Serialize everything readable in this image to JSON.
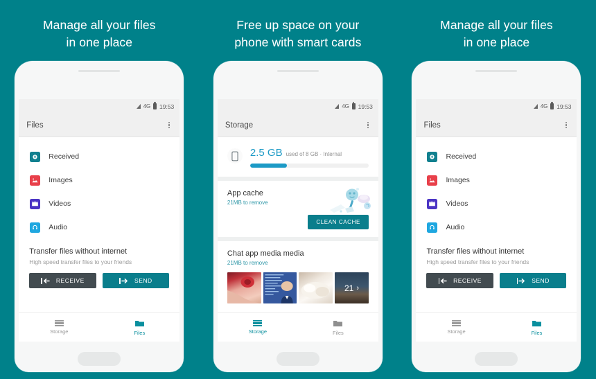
{
  "theme": {
    "background_teal": "#00818a",
    "accent_teal": "#0a7e8c",
    "nav_active": "#0a8f9e",
    "progress_blue": "#1c9ac6",
    "receive_dark": "#424b50"
  },
  "panels": [
    {
      "headline_line1": "Manage all your files",
      "headline_line2": "in one place",
      "screen": "files"
    },
    {
      "headline_line1": "Free up space on your",
      "headline_line2": "phone with smart cards",
      "screen": "storage"
    },
    {
      "headline_line1": "Manage all your files",
      "headline_line2": "in one place",
      "screen": "files"
    }
  ],
  "status_bar": {
    "network": "4G",
    "time": "19:53",
    "signal_icon": "signal-triangle-icon",
    "battery_icon": "battery-icon"
  },
  "files_screen": {
    "app_bar": {
      "title": "Files",
      "overflow_icon": "kebab-menu-icon"
    },
    "items": [
      {
        "label": "Received",
        "icon": "received-icon",
        "color": "#11808f"
      },
      {
        "label": "Images",
        "icon": "images-icon",
        "color": "#e8404a"
      },
      {
        "label": "Videos",
        "icon": "videos-icon",
        "color": "#4b34c4"
      },
      {
        "label": "Audio",
        "icon": "audio-icon",
        "color": "#1fa7e0"
      }
    ],
    "transfer": {
      "title": "Transfer files without internet",
      "subtitle": "High speed transfer files to your friends",
      "receive_label": "RECEIVE",
      "send_label": "SEND",
      "receive_icon": "arrow-left-to-bar-icon",
      "send_icon": "arrow-right-to-bar-icon"
    },
    "bottom_nav": [
      {
        "label": "Storage",
        "icon": "storage-stack-icon",
        "active": false
      },
      {
        "label": "Files",
        "icon": "folder-icon",
        "active": true
      }
    ]
  },
  "storage_screen": {
    "app_bar": {
      "title": "Storage",
      "overflow_icon": "kebab-menu-icon"
    },
    "hero": {
      "device_icon": "phone-icon",
      "used": "2.5 GB",
      "detail": "used of 8 GB · Internal",
      "percent": 31
    },
    "cards": [
      {
        "title": "App cache",
        "subtitle": "21MB to remove",
        "action_label": "CLEAN CACHE",
        "illustration": "cleaning-illustration"
      },
      {
        "title": "Chat app media media",
        "subtitle": "21MB to remove",
        "thumbnails": [
          {
            "name": "thumb-rose-hands"
          },
          {
            "name": "thumb-document-portrait"
          },
          {
            "name": "thumb-white-object"
          },
          {
            "name": "thumb-cityscape-more",
            "count": "21",
            "chevron": "›"
          }
        ]
      }
    ],
    "bottom_nav": [
      {
        "label": "Storage",
        "icon": "storage-stack-icon",
        "active": true
      },
      {
        "label": "Files",
        "icon": "folder-icon",
        "active": false
      }
    ]
  }
}
